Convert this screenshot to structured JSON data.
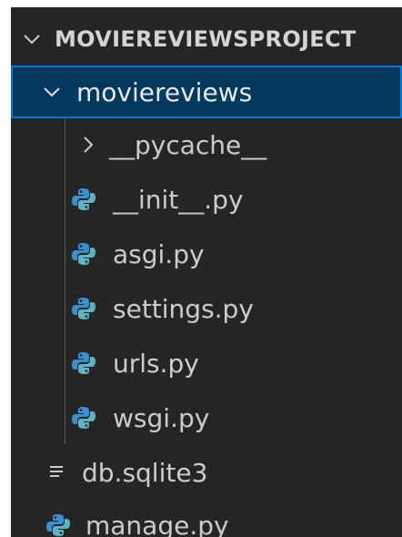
{
  "explorer": {
    "project_title": "MOVIEREVIEWSPROJECT",
    "items": [
      {
        "label": "movierevie​ws",
        "type": "folder",
        "expanded": true
      },
      {
        "label": "__pycache__",
        "type": "folder",
        "expanded": false
      },
      {
        "label": "__init__.py",
        "type": "python-file"
      },
      {
        "label": "asgi.py",
        "type": "python-file"
      },
      {
        "label": "settings.py",
        "type": "python-file"
      },
      {
        "label": "urls.py",
        "type": "python-file"
      },
      {
        "label": "wsgi.py",
        "type": "python-file"
      },
      {
        "label": "db.sqlite3",
        "type": "file"
      },
      {
        "label": "manage.py",
        "type": "python-file"
      }
    ]
  },
  "colors": {
    "background": "#252526",
    "selection": "#04395e",
    "selection_border": "#0078d4",
    "python_blue": "#3d8fcf",
    "python_teal": "#5fb3c4"
  }
}
